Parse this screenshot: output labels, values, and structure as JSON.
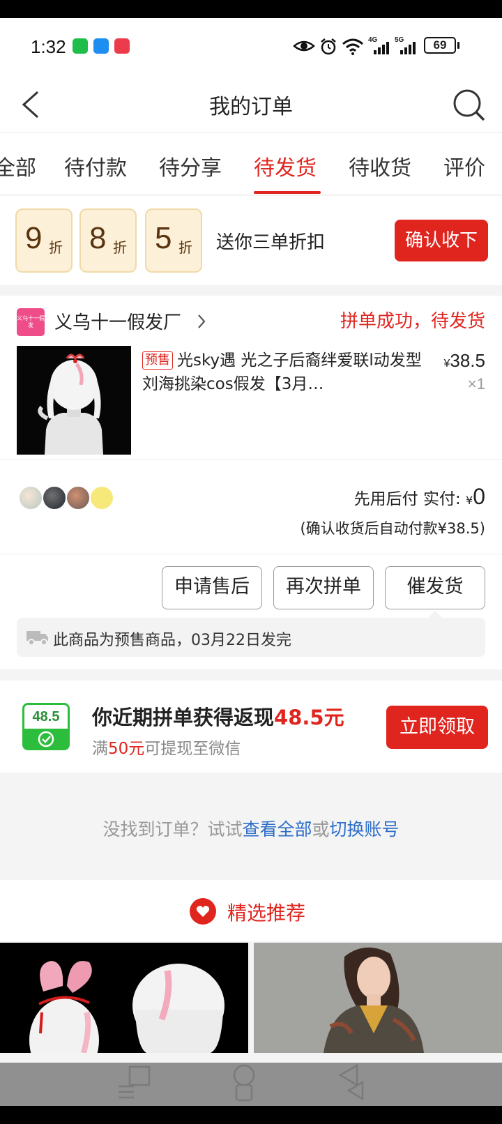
{
  "status_bar": {
    "time": "1:32",
    "battery": "69",
    "network_4g": "4G",
    "network_5g": "5G"
  },
  "header": {
    "title": "我的订单"
  },
  "tabs": [
    {
      "label": "全部",
      "active": false
    },
    {
      "label": "待付款",
      "active": false
    },
    {
      "label": "待分享",
      "active": false
    },
    {
      "label": "待发货",
      "active": true
    },
    {
      "label": "待收货",
      "active": false
    },
    {
      "label": "评价",
      "active": false
    }
  ],
  "promo": {
    "coupons": [
      {
        "num": "9",
        "unit": "折"
      },
      {
        "num": "8",
        "unit": "折"
      },
      {
        "num": "5",
        "unit": "折"
      }
    ],
    "text": "送你三单折扣",
    "button": "确认收下"
  },
  "order": {
    "shop_logo_text": "义乌十一假发",
    "shop_name": "义乌十一假发厂",
    "status": "拼单成功，待发货",
    "tag": "预售",
    "product_title": "光sky遇 光之子后裔绊爱联l动发型刘海挑染cos假发【3月…",
    "price_symbol": "¥",
    "price": "38.5",
    "qty": "×1",
    "pay_label": "先用后付 实付: ",
    "pay_amount": "0",
    "pay_note": "(确认收货后自动付款¥38.5)",
    "actions": [
      "申请售后",
      "再次拼单",
      "催发货"
    ],
    "notice": "此商品为预售商品，03月22日发完"
  },
  "cashback": {
    "icon_amount": "48.5",
    "title_prefix": "你近期拼单获得返现",
    "title_amount": "48.5元",
    "sub_prefix": "满",
    "sub_amount": "50元",
    "sub_suffix": "可提现至微信",
    "button": "立即领取"
  },
  "not_found": {
    "prefix": "没找到订单？试试",
    "link1": "查看全部",
    "middle": "或",
    "link2": "切换账号"
  },
  "recommend": {
    "label": "精选推荐"
  },
  "colors": {
    "accent": "#e0251f",
    "link": "#2d6ec8",
    "coupon_bg": "#fdf0d9",
    "cashback_green": "#2dbd3c"
  }
}
